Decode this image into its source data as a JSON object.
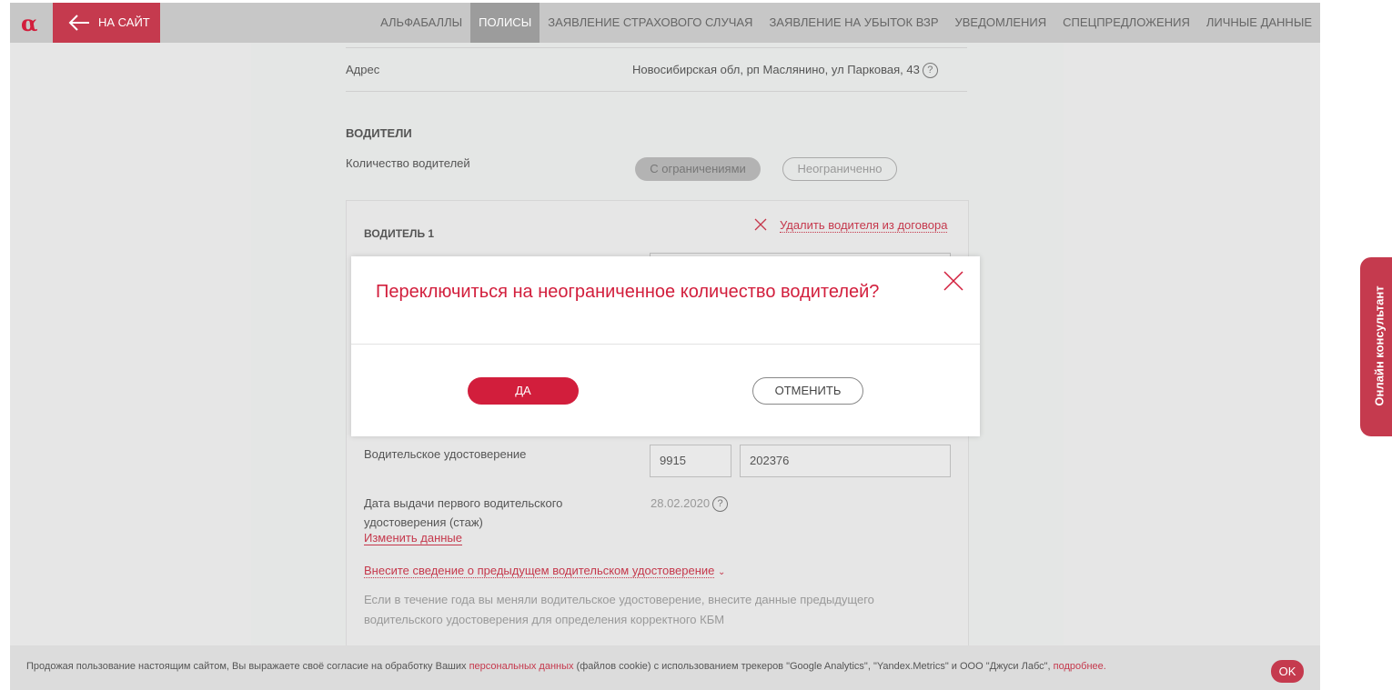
{
  "header": {
    "logo": "α",
    "back_label": "НА САЙТ",
    "nav": [
      {
        "label": "АЛЬФАБАЛЛЫ"
      },
      {
        "label": "ПОЛИСЫ"
      },
      {
        "label": "ЗАЯВЛЕНИЕ СТРАХОВОГО СЛУЧАЯ"
      },
      {
        "label": "ЗАЯВЛЕНИЕ НА УБЫТОК ВЗР"
      },
      {
        "label": "УВЕДОМЛЕНИЯ"
      },
      {
        "label": "СПЕЦПРЕДЛОЖЕНИЯ"
      },
      {
        "label": "ЛИЧНЫЕ ДАННЫЕ"
      }
    ],
    "active_nav": "ПОЛИСЫ"
  },
  "address": {
    "label": "Адрес",
    "value": "Новосибирская обл, рп Маслянино, ул Парковая, 43"
  },
  "drivers": {
    "heading": "ВОДИТЕЛИ",
    "count_label": "Количество водителей",
    "option_limited": "С ограничениями",
    "option_unlimited": "Неограниченно",
    "selected": "С ограничениями",
    "driver1": {
      "title": "ВОДИТЕЛЬ 1",
      "remove_label": "Удалить водителя из договора",
      "license_label": "Водительское удостоверение",
      "license_series": "9915",
      "license_number": "202376",
      "first_issue_label_line1": "Дата выдачи первого водительского",
      "first_issue_label_line2": "удостоверения (стаж)",
      "first_issue_date": "28.02.2020",
      "change_link": "Изменить данные",
      "prev_license_link": "Внесите сведение о предыдущем водительском удостоверение",
      "hint_line1": "Если в течение года вы меняли водительское удостоверение, внесите данные предыдущего",
      "hint_line2": "водительского удостоверения для определения корректного КБМ"
    }
  },
  "modal": {
    "title": "Переключиться на неограниченное количество водителей?",
    "yes_label": "ДА",
    "cancel_label": "ОТМЕНИТЬ"
  },
  "side_tab": {
    "label": "Онлайн консультант"
  },
  "cookie": {
    "text_before": "Продожая пользование настоящим сайтом, Вы выражаете своё согласие на обработку Ваших ",
    "link1": "персональных данных",
    "text_middle": " (файлов cookie) с использованием трекеров \"Google Analytics\",  \"Yandex.Metrics\" и ООО \"Джуси Лабс\", ",
    "link2": "подробнее.",
    "ok_label": "OK"
  },
  "colors": {
    "brand_red": "#d21e3c",
    "nav_bg": "#c7c7c7",
    "overlay_bg": "#e6e6e6"
  },
  "icons": [
    "alfa-logo-icon",
    "arrow-left-icon",
    "question-icon",
    "close-x-icon",
    "chevron-down-icon"
  ]
}
